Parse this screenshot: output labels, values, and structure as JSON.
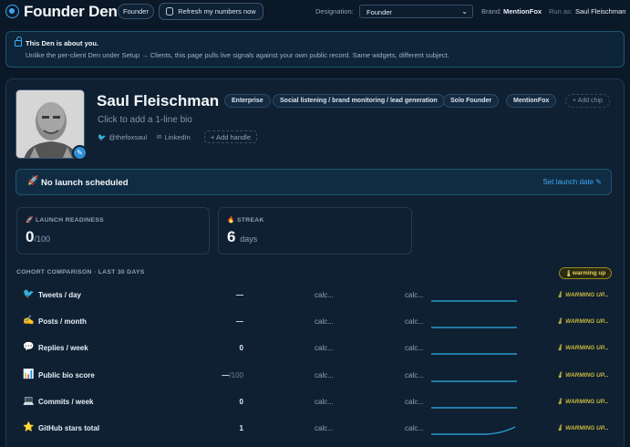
{
  "header": {
    "app_title": "Founder Den",
    "founder_pill": "Founder",
    "refresh_label": "Refresh my numbers now",
    "designation_label": "Designation:",
    "designation_value": "Founder",
    "brand_label": "Brand:",
    "brand_value": "MentionFox",
    "runas_label": "Run as:",
    "runas_value": "Saul Fleischman"
  },
  "notice": {
    "title": "This Den is about you.",
    "body": "Unlike the per-client Den under Setup → Clients, this page pulls live signals against your own public record. Same widgets, different subject."
  },
  "profile": {
    "name": "Saul Fleischman",
    "chips": [
      "Enterprise",
      "Social listening / brand monitoring / lead generation",
      "Solo Founder",
      "MentionFox"
    ],
    "add_chip": "+ Add chip",
    "bio_placeholder": "Click to add a 1-line bio",
    "twitter_handle": "@thefoxsaul",
    "linkedin_label": "LinkedIn",
    "add_handle": "+ Add handle"
  },
  "launch": {
    "text": "No launch scheduled",
    "link": "Set launch date"
  },
  "stats": {
    "readiness_label": "LAUNCH READINESS",
    "readiness_value": "0",
    "readiness_unit": "/100",
    "streak_label": "STREAK",
    "streak_value": "6",
    "streak_unit": "days"
  },
  "cohort": {
    "title": "COHORT COMPARISON · LAST 30 DAYS",
    "badge": "warming up",
    "rows": [
      {
        "label": "Tweets / day",
        "value": "—",
        "suffix": "",
        "calc1": "calc...",
        "calc2": "calc...",
        "status": "WARMING UP..."
      },
      {
        "label": "Posts / month",
        "value": "—",
        "suffix": "",
        "calc1": "calc...",
        "calc2": "calc...",
        "status": "WARMING UP..."
      },
      {
        "label": "Replies / week",
        "value": "0",
        "suffix": "",
        "calc1": "calc...",
        "calc2": "calc...",
        "status": "WARMING UP..."
      },
      {
        "label": "Public bio score",
        "value": "—",
        "suffix": "/100",
        "calc1": "calc...",
        "calc2": "calc...",
        "status": "WARMING UP..."
      },
      {
        "label": "Commits / week",
        "value": "0",
        "suffix": "",
        "calc1": "calc...",
        "calc2": "calc...",
        "status": "WARMING UP..."
      },
      {
        "label": "GitHub stars total",
        "value": "1",
        "suffix": "",
        "calc1": "calc...",
        "calc2": "calc...",
        "status": "WARMING UP..."
      }
    ]
  },
  "colors": {
    "accent": "#3fa9f5",
    "warning": "#e5d45a",
    "background": "#0b1828"
  }
}
